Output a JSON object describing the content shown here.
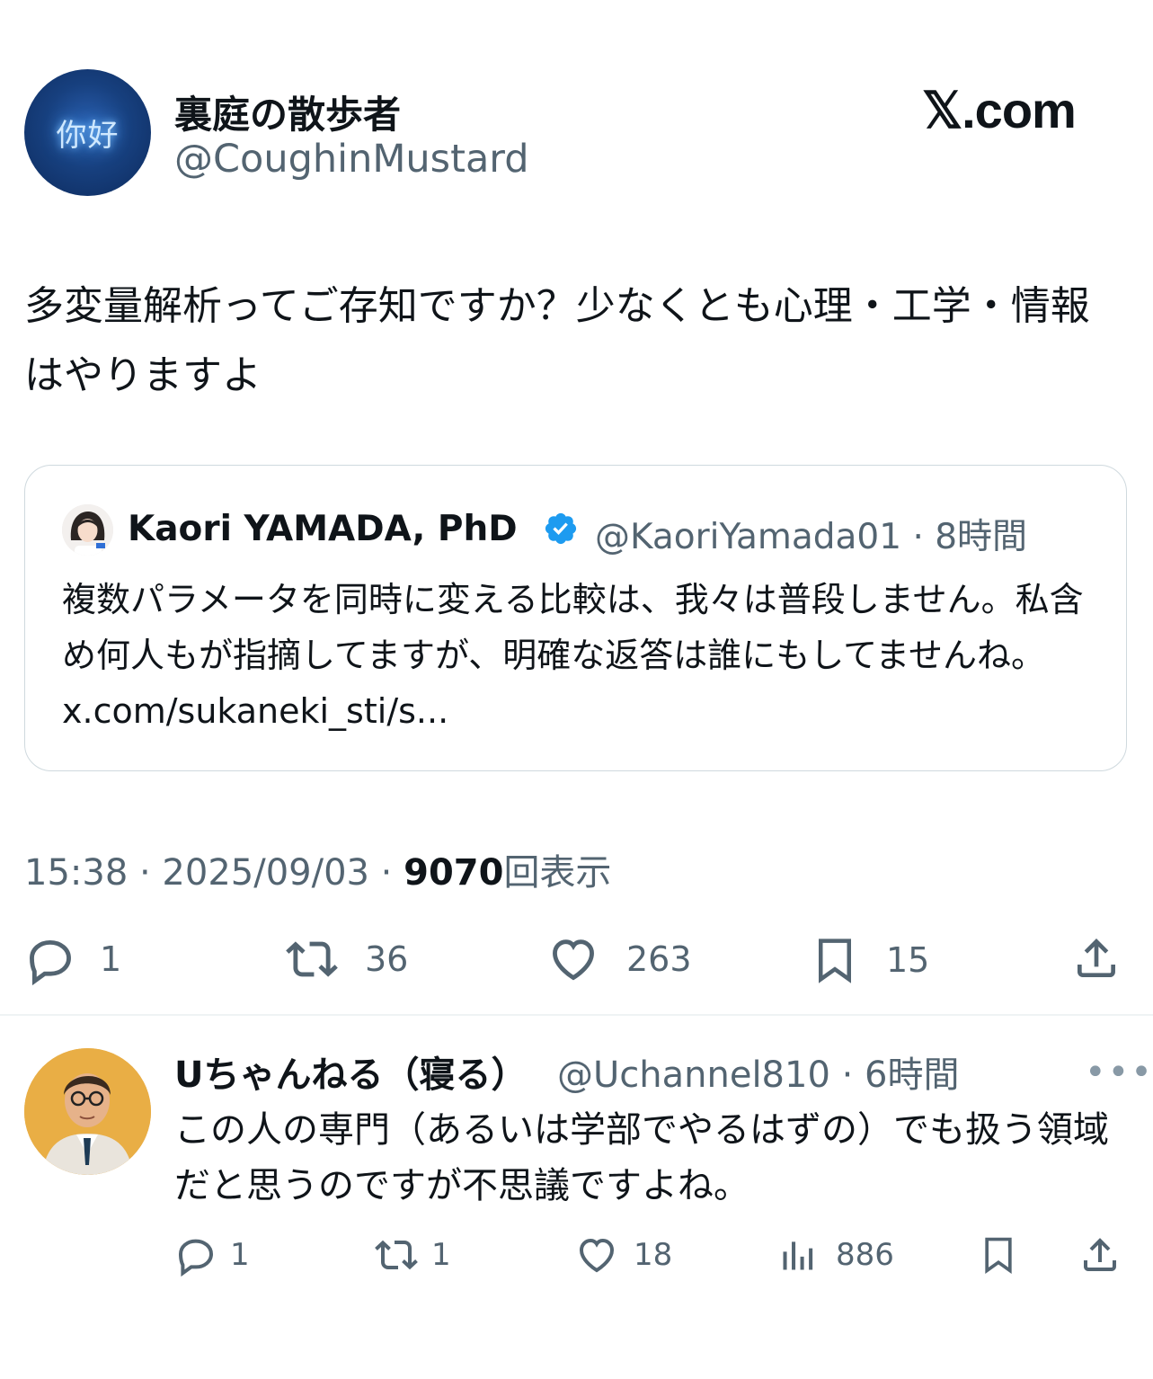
{
  "tweet": {
    "avatar_text": "你好",
    "display_name": "裏庭の散歩者",
    "handle": "@CoughinMustard",
    "brand": "𝕏.com",
    "text": "多変量解析ってご存知ですか？少なくとも心理・工学・情報はやりますよ",
    "quote": {
      "name": "Kaori YAMADA, PhD",
      "handle_time": "@KaoriYamada01 · 8時間",
      "text": "複数パラメータを同時に変える比較は、我々は普段しません。私含め何人もが指摘してますが、明確な返答は誰にもしてませんね。",
      "link": "x.com/sukaneki_sti/s..."
    },
    "time": "15:38 · 2025/09/03 · ",
    "views_count": "9070",
    "views_label": "回表示",
    "actions": {
      "reply_count": "1",
      "retweet_count": "36",
      "like_count": "263",
      "bookmark_count": "15"
    }
  },
  "reply": {
    "name": "Uちゃんねる（寝る）",
    "handle_time": "@Uchannel810 · 6時間",
    "more": "•••",
    "text": "この人の専門（あるいは学部でやるはずの）でも扱う領域だと思うのですが不思議ですよね。",
    "actions": {
      "reply_count": "1",
      "retweet_count": "1",
      "like_count": "18",
      "views_count": "886"
    }
  },
  "colors": {
    "text_primary": "#0f1419",
    "text_secondary": "#536471",
    "verified_blue": "#1d9bf0",
    "border": "#cfd9de"
  },
  "icons": [
    "reply-icon",
    "retweet-icon",
    "like-icon",
    "bookmark-icon",
    "share-icon",
    "views-icon",
    "verified-badge-icon",
    "more-icon"
  ]
}
